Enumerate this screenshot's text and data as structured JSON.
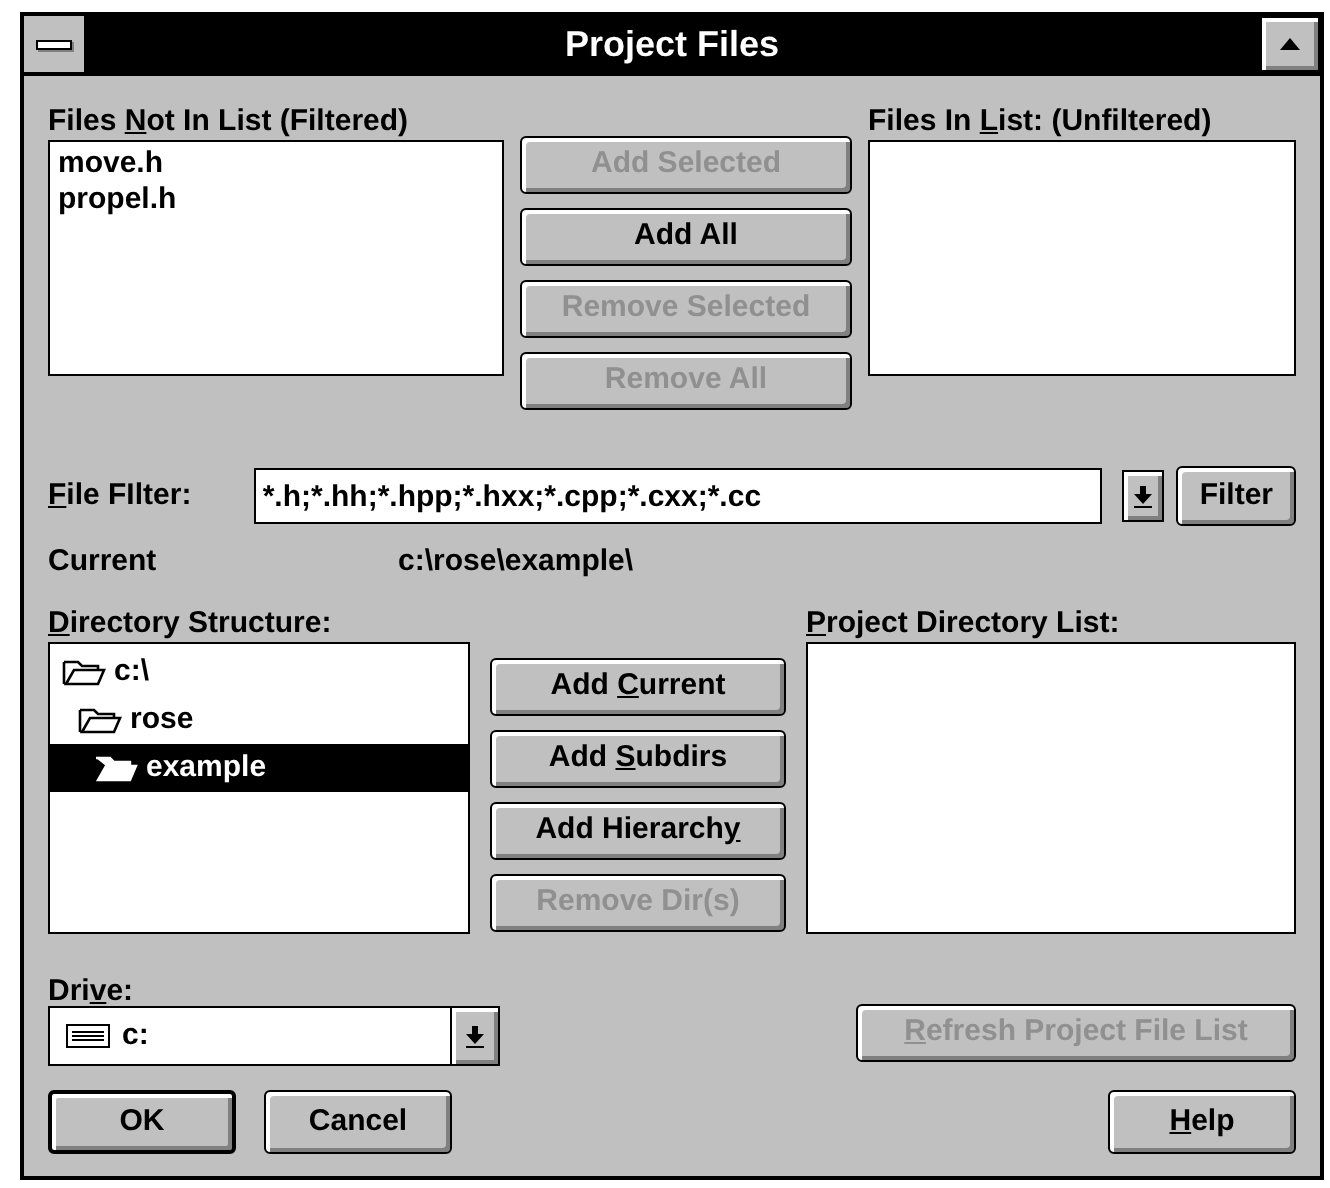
{
  "window": {
    "title": "Project Files"
  },
  "files_not_in_list": {
    "label": [
      {
        "text": "Files ",
        "underlined": false
      },
      {
        "text": "N",
        "underlined": true
      },
      {
        "text": "ot In List (Filtered)",
        "underlined": false
      }
    ],
    "items": [
      "move.h",
      "propel.h"
    ]
  },
  "file_buttons": [
    {
      "label": [
        {
          "text": "Add Selected",
          "underlined": false
        }
      ],
      "disabled": true
    },
    {
      "label": [
        {
          "text": "Add All",
          "underlined": false
        }
      ],
      "disabled": false
    },
    {
      "label": [
        {
          "text": "Remove Selected",
          "underlined": false
        }
      ],
      "disabled": true
    },
    {
      "label": [
        {
          "text": "Remove All",
          "underlined": false
        }
      ],
      "disabled": true
    }
  ],
  "files_in_list": {
    "label": [
      {
        "text": "Files In ",
        "underlined": false
      },
      {
        "text": "L",
        "underlined": true
      },
      {
        "text": "ist: (Unfiltered)",
        "underlined": false
      }
    ]
  },
  "file_filter": {
    "label": [
      {
        "text": "F",
        "underlined": true
      },
      {
        "text": "ile FIlter:",
        "underlined": false
      }
    ],
    "value": "*.h;*.hh;*.hpp;*.hxx;*.cpp;*.cxx;*.cc",
    "button": "Filter"
  },
  "current": {
    "label": "Current",
    "value": "c:\\rose\\example\\"
  },
  "directory_structure": {
    "label": [
      {
        "text": "D",
        "underlined": true
      },
      {
        "text": "irectory Structure:",
        "underlined": false
      }
    ],
    "tree": [
      {
        "name": "c:\\",
        "selected": false,
        "children": [
          {
            "name": "rose",
            "selected": false,
            "children": [
              {
                "name": "example",
                "selected": true
              }
            ]
          }
        ]
      }
    ]
  },
  "dir_buttons": [
    {
      "label": [
        {
          "text": "Add ",
          "underlined": false
        },
        {
          "text": "C",
          "underlined": true
        },
        {
          "text": "urrent",
          "underlined": false
        }
      ],
      "disabled": false
    },
    {
      "label": [
        {
          "text": "Add ",
          "underlined": false
        },
        {
          "text": "S",
          "underlined": true
        },
        {
          "text": "ubdirs",
          "underlined": false
        }
      ],
      "disabled": false
    },
    {
      "label": [
        {
          "text": "Add Hierarch",
          "underlined": false
        },
        {
          "text": "y",
          "underlined": true
        }
      ],
      "disabled": false
    },
    {
      "label": [
        {
          "text": "Remove Dir(s)",
          "underlined": false
        }
      ],
      "disabled": true
    }
  ],
  "project_directory_list": {
    "label": [
      {
        "text": "P",
        "underlined": true
      },
      {
        "text": "roject Directory List:",
        "underlined": false
      }
    ]
  },
  "drive": {
    "label": [
      {
        "text": "Dri",
        "underlined": false
      },
      {
        "text": "v",
        "underlined": true
      },
      {
        "text": "e:",
        "underlined": false
      }
    ],
    "value": "c:"
  },
  "refresh_button": {
    "label": [
      {
        "text": "R",
        "underlined": true
      },
      {
        "text": "efresh Project File List",
        "underlined": false
      }
    ],
    "disabled": true
  },
  "buttons": [
    {
      "label": [
        {
          "text": "OK",
          "underlined": false
        }
      ],
      "default": true
    },
    {
      "label": [
        {
          "text": "Cancel",
          "underlined": false
        }
      ],
      "default": false
    },
    {
      "label": [
        {
          "text": "H",
          "underlined": true
        },
        {
          "text": "elp",
          "underlined": false
        }
      ],
      "default": false
    }
  ]
}
